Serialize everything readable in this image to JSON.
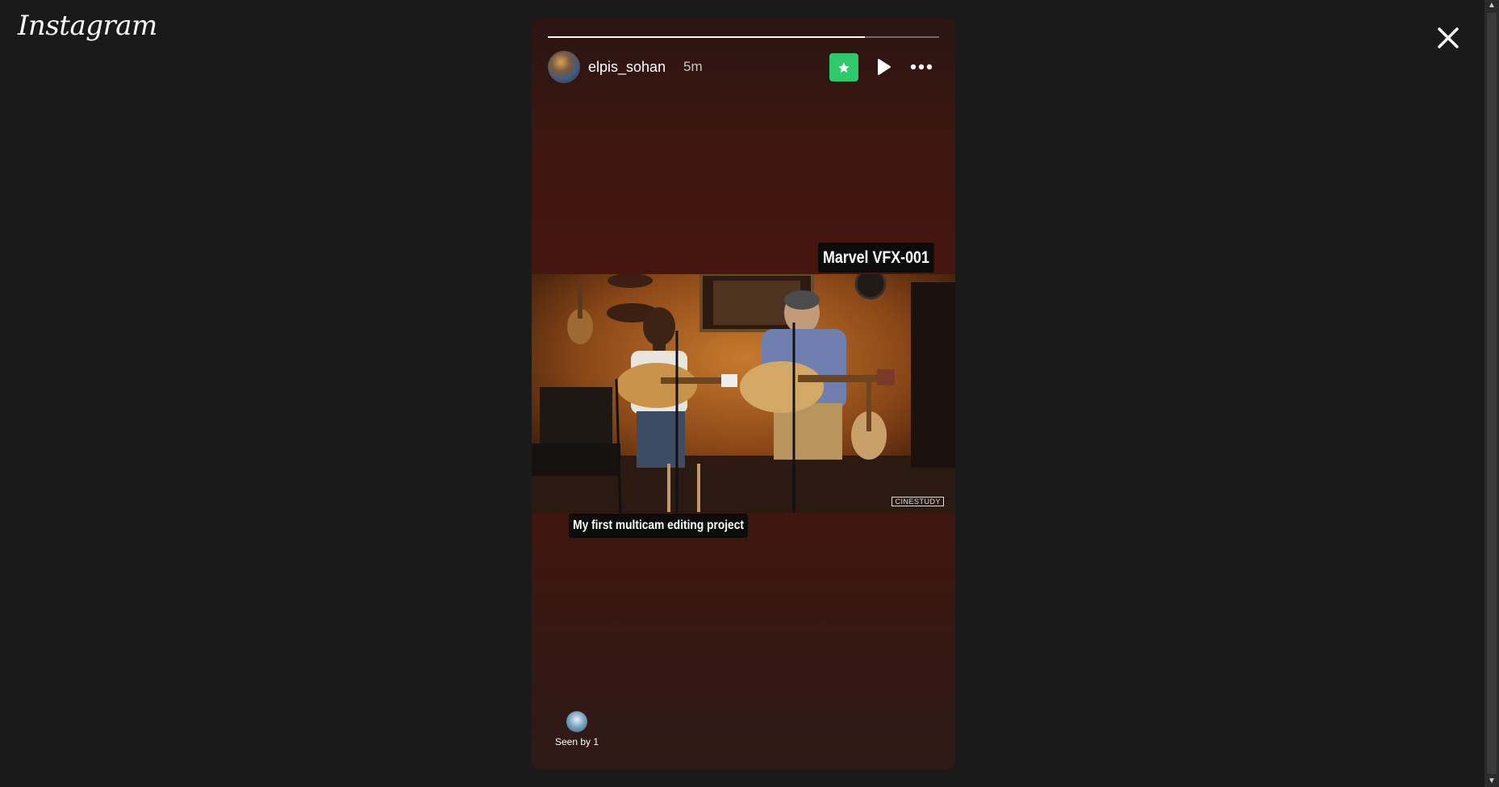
{
  "app": {
    "logo_text": "Instagram"
  },
  "story": {
    "username": "elpis_sohan",
    "time_ago": "5m",
    "progress_fraction": 0.81,
    "sticker_text": "Marvel VFX-001",
    "caption_text": "My first multicam editing project",
    "seen_by_text": "Seen by 1",
    "video_watermark": "CINESTUDY"
  },
  "icons": {
    "close": "close-icon",
    "star": "star-icon",
    "play": "play-icon",
    "more": "more-options-icon"
  },
  "colors": {
    "badge_green": "#2ec96b",
    "background": "#1a1a1a"
  }
}
